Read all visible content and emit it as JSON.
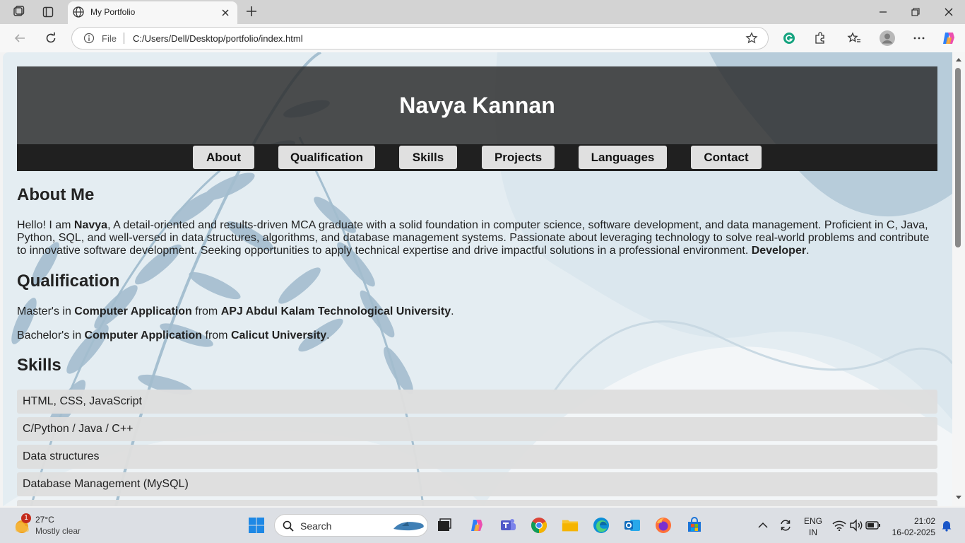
{
  "browser": {
    "tab_title": "My Portfolio",
    "address": {
      "scheme_label": "File",
      "url": "C:/Users/Dell/Desktop/portfolio/index.html"
    }
  },
  "page": {
    "site_name": "Navya Kannan",
    "nav": [
      "About",
      "Qualification",
      "Skills",
      "Projects",
      "Languages",
      "Contact"
    ],
    "about": {
      "heading": "About Me",
      "intro": "Hello! I am ",
      "name": "Navya",
      "text": ", A detail-oriented and results-driven MCA graduate with a solid foundation in computer science, software development, and data management. Proficient in C, Java, Python, SQL, and well-versed in data structures, algorithms, and database management systems. Passionate about leveraging technology to solve real-world problems and contribute to innovative software development. Seeking opportunities to apply technical expertise and drive impactful solutions in a professional environment. ",
      "role": "Developer",
      "end": "."
    },
    "qualification": {
      "heading": "Qualification",
      "items": [
        {
          "prefix": "Master's in ",
          "degree": "Computer Application",
          "mid": " from ",
          "university": "APJ Abdul Kalam Technological University",
          "end": "."
        },
        {
          "prefix": "Bachelor's in ",
          "degree": "Computer Application",
          "mid": " from ",
          "university": "Calicut University",
          "end": "."
        }
      ]
    },
    "skills": {
      "heading": "Skills",
      "items": [
        "HTML, CSS, JavaScript",
        "C/Python / Java / C++",
        "Data structures",
        "Database Management (MySQL)"
      ]
    }
  },
  "taskbar": {
    "weather": {
      "temp": "27°C",
      "desc": "Mostly clear",
      "badge": "1"
    },
    "search_label": "Search",
    "lang": {
      "line1": "ENG",
      "line2": "IN"
    },
    "clock": {
      "time": "21:02",
      "date": "16-02-2025"
    }
  },
  "colors": {
    "header_bg": "#454545",
    "nav_bg": "#202020",
    "nav_button": "#e0e0e0",
    "skill_bg": "#dedede"
  },
  "icons": [
    "workspaces-icon",
    "tab-actions-icon",
    "globe-icon",
    "close-icon",
    "plus-icon",
    "minimize-icon",
    "restore-icon",
    "back-icon",
    "reload-icon",
    "info-icon",
    "star-icon",
    "grammarly-icon",
    "extensions-icon",
    "favorites-icon",
    "profile-icon",
    "more-icon",
    "copilot-icon",
    "windows-start-icon",
    "search-icon",
    "file-explorer-icon",
    "edge-icon",
    "chrome-icon",
    "teams-icon",
    "outlook-icon",
    "firefox-icon",
    "store-icon",
    "wifi-icon",
    "volume-icon",
    "battery-icon",
    "notification-bell-icon"
  ]
}
